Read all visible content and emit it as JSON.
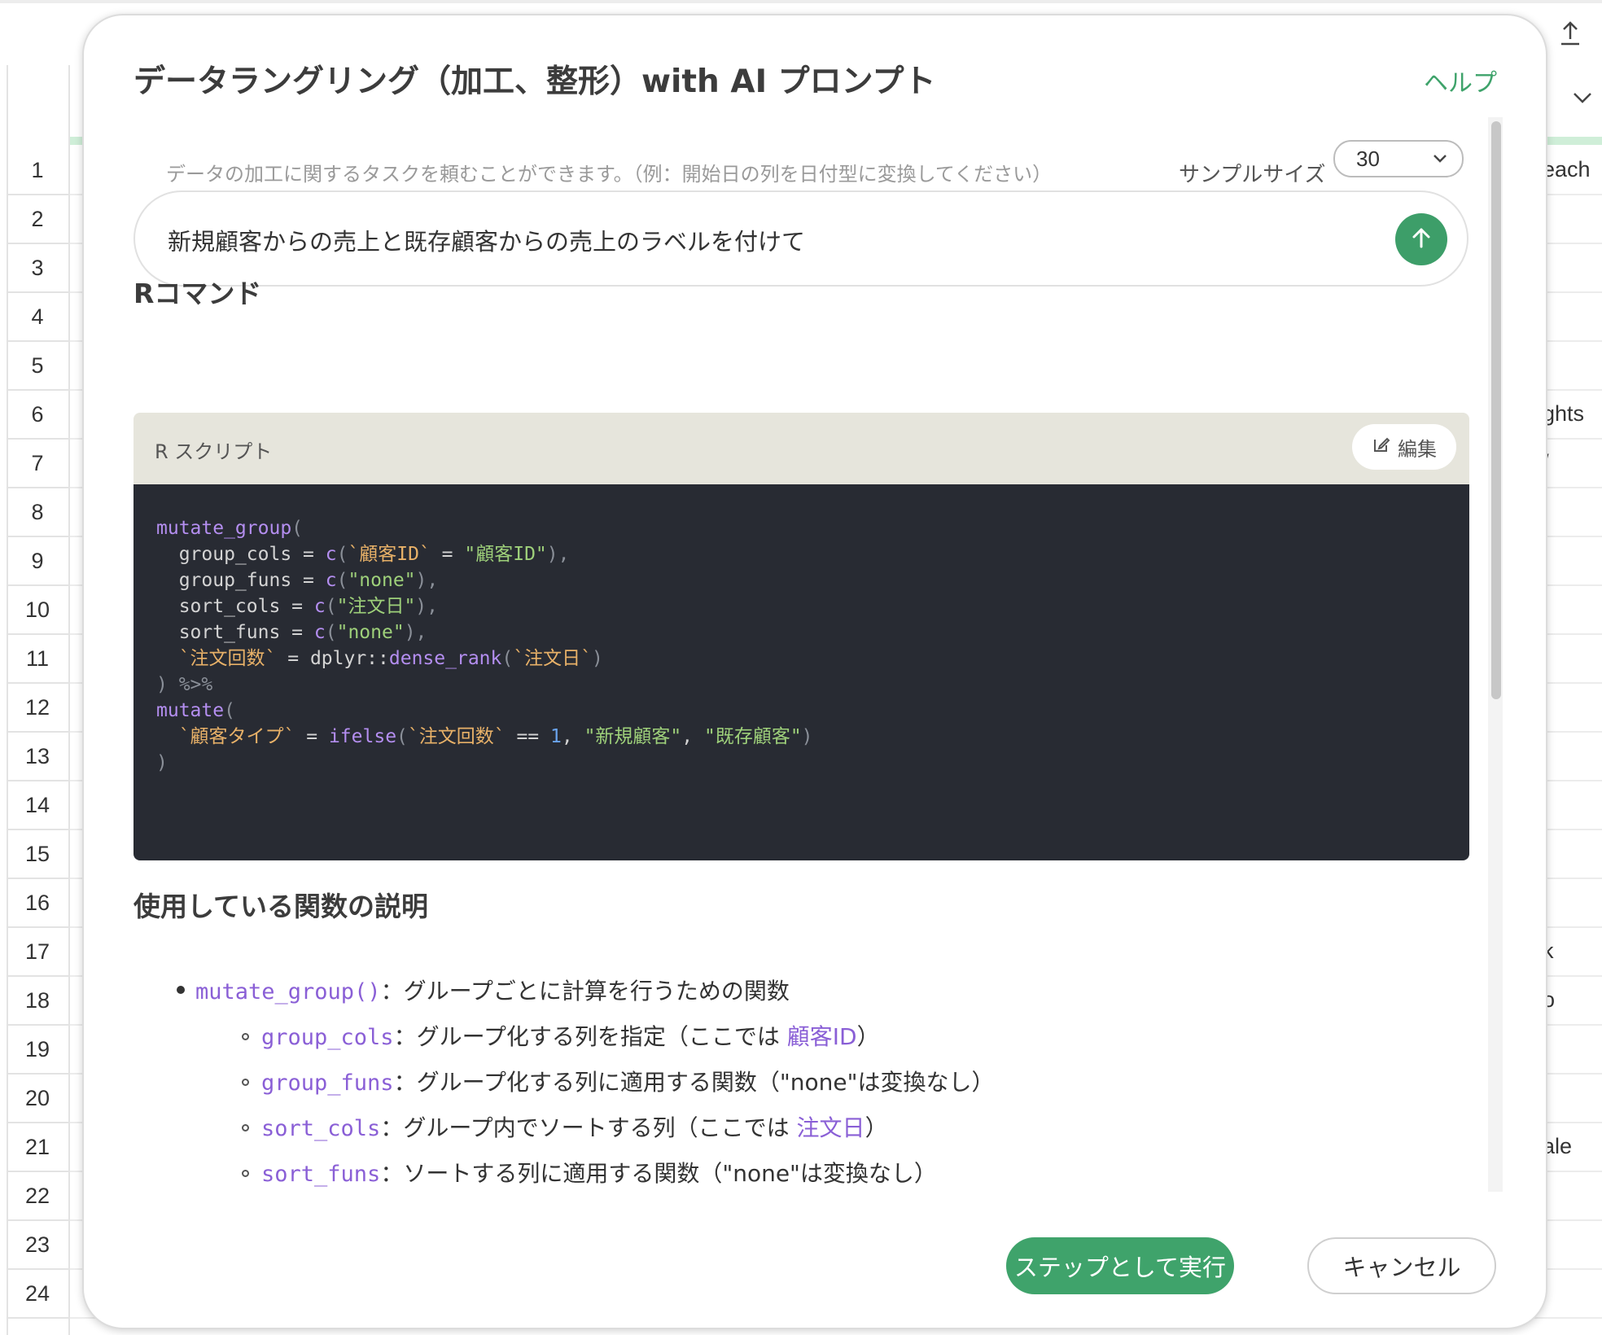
{
  "background_sheet": {
    "row_numbers": [
      "1",
      "2",
      "3",
      "4",
      "5",
      "6",
      "7",
      "8",
      "9",
      "10",
      "11",
      "12",
      "13",
      "14",
      "15",
      "16",
      "17",
      "18",
      "19",
      "20",
      "21",
      "22",
      "23",
      "24"
    ],
    "side_texts": [
      {
        "row": "1",
        "text": "each"
      },
      {
        "row": "6",
        "text": "ghts"
      },
      {
        "row": "7",
        "text": "/"
      },
      {
        "row": "17",
        "text": "k"
      },
      {
        "row": "18",
        "text": "o"
      },
      {
        "row": "21",
        "text": "ale"
      }
    ],
    "upload_icon": "upload-icon",
    "chevron_icon": "chevron-down-icon"
  },
  "modal": {
    "title": "データラングリング（加工、整形）with AI プロンプト",
    "help_label": "ヘルプ",
    "hint": "データの加工に関するタスクを頼むことができます。（例：開始日の列を日付型に変換してください）",
    "sample_size_label": "サンプルサイズ",
    "sample_size_value": "30",
    "prompt_text": "新規顧客からの売上と既存顧客からの売上のラベルを付けて",
    "r_command_heading": "Rコマンド",
    "script_label": "R スクリプト",
    "edit_label": "編集",
    "code": [
      [
        {
          "t": "mutate_group",
          "c": "fn"
        },
        {
          "t": "(",
          "c": "punc"
        }
      ],
      [
        {
          "t": "  group_cols = ",
          "c": "op"
        },
        {
          "t": "c",
          "c": "fn"
        },
        {
          "t": "(",
          "c": "punc"
        },
        {
          "t": "`顧客ID`",
          "c": "sym"
        },
        {
          "t": " = ",
          "c": "op"
        },
        {
          "t": "\"顧客ID\"",
          "c": "str"
        },
        {
          "t": "),",
          "c": "punc"
        }
      ],
      [
        {
          "t": "  group_funs = ",
          "c": "op"
        },
        {
          "t": "c",
          "c": "fn"
        },
        {
          "t": "(",
          "c": "punc"
        },
        {
          "t": "\"none\"",
          "c": "str"
        },
        {
          "t": "),",
          "c": "punc"
        }
      ],
      [
        {
          "t": "  sort_cols = ",
          "c": "op"
        },
        {
          "t": "c",
          "c": "fn"
        },
        {
          "t": "(",
          "c": "punc"
        },
        {
          "t": "\"注文日\"",
          "c": "str"
        },
        {
          "t": "),",
          "c": "punc"
        }
      ],
      [
        {
          "t": "  sort_funs = ",
          "c": "op"
        },
        {
          "t": "c",
          "c": "fn"
        },
        {
          "t": "(",
          "c": "punc"
        },
        {
          "t": "\"none\"",
          "c": "str"
        },
        {
          "t": "),",
          "c": "punc"
        }
      ],
      [
        {
          "t": "  ",
          "c": "op"
        },
        {
          "t": "`注文回数`",
          "c": "sym"
        },
        {
          "t": " = dplyr::",
          "c": "op"
        },
        {
          "t": "dense_rank",
          "c": "fn"
        },
        {
          "t": "(",
          "c": "punc"
        },
        {
          "t": "`注文日`",
          "c": "sym"
        },
        {
          "t": ")",
          "c": "punc"
        }
      ],
      [
        {
          "t": ") %>%",
          "c": "punc"
        }
      ],
      [
        {
          "t": "mutate",
          "c": "fn"
        },
        {
          "t": "(",
          "c": "punc"
        }
      ],
      [
        {
          "t": "  ",
          "c": "op"
        },
        {
          "t": "`顧客タイプ`",
          "c": "sym"
        },
        {
          "t": " = ",
          "c": "op"
        },
        {
          "t": "ifelse",
          "c": "fn"
        },
        {
          "t": "(",
          "c": "punc"
        },
        {
          "t": "`注文回数`",
          "c": "sym"
        },
        {
          "t": " == ",
          "c": "op"
        },
        {
          "t": "1",
          "c": "num"
        },
        {
          "t": ", ",
          "c": "op"
        },
        {
          "t": "\"新規顧客\"",
          "c": "str"
        },
        {
          "t": ", ",
          "c": "op"
        },
        {
          "t": "\"既存顧客\"",
          "c": "str"
        },
        {
          "t": ")",
          "c": "punc"
        }
      ],
      [
        {
          "t": ")",
          "c": "punc"
        }
      ]
    ],
    "functions_heading": "使用している関数の説明",
    "functions": {
      "main": {
        "name": "mutate_group()",
        "desc": "：グループごとに計算を行うための関数"
      },
      "sub": [
        {
          "name": "group_cols",
          "desc": "：グループ化する列を指定（ここでは ",
          "highlight": "顧客ID",
          "tail": "）"
        },
        {
          "name": "group_funs",
          "desc": "：グループ化する列に適用する関数（\"none\"は変換なし）",
          "highlight": "",
          "tail": ""
        },
        {
          "name": "sort_cols",
          "desc": "：グループ内でソートする列（ここでは ",
          "highlight": "注文日",
          "tail": "）"
        },
        {
          "name": "sort_funs",
          "desc": "：ソートする列に適用する関数（\"none\"は変換なし）",
          "highlight": "",
          "tail": ""
        }
      ]
    },
    "run_button": "ステップとして実行",
    "cancel_button": "キャンセル",
    "icons": {
      "send": "arrow-up-icon",
      "edit": "edit-icon",
      "select": "chevron-down-icon"
    }
  }
}
